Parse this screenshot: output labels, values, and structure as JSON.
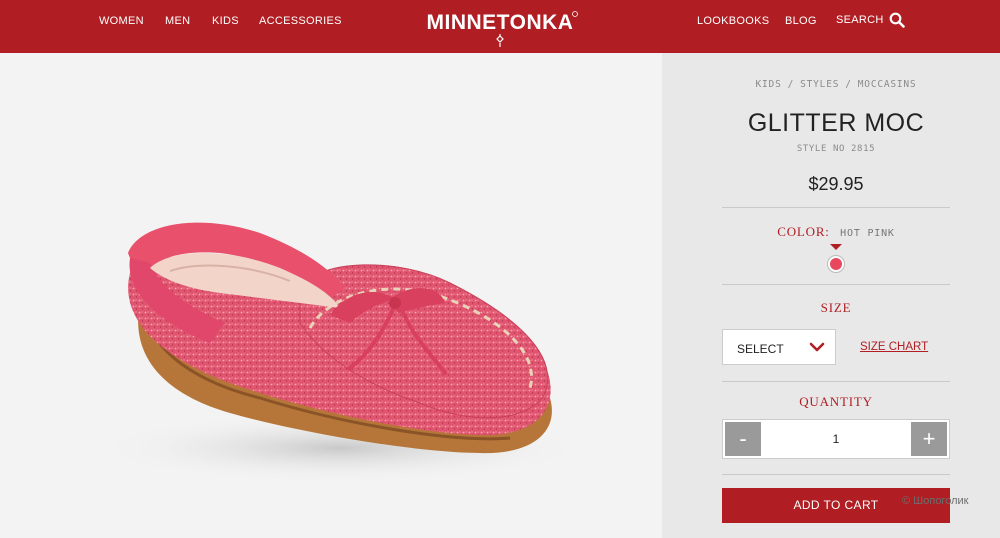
{
  "header": {
    "nav_left": [
      "WOMEN",
      "MEN",
      "KIDS",
      "ACCESSORIES"
    ],
    "logo": "MINNETONKA",
    "nav_right": [
      "LOOKBOOKS",
      "BLOG"
    ],
    "search_label": "SEARCH",
    "bg_color": "#b01e23"
  },
  "product": {
    "breadcrumb": [
      "KIDS",
      "STYLES",
      "MOCCASINS"
    ],
    "breadcrumb_separator": "/",
    "title": "GLITTER MOC",
    "style_no": "STYLE NO 2815",
    "price": "$29.95",
    "color_label": "COLOR:",
    "color_value": "HOT PINK",
    "swatch_color": "#e8475e",
    "size_label": "SIZE",
    "size_select": "SELECT",
    "size_chart_link": "SIZE CHART",
    "quantity_label": "QUANTITY",
    "quantity_minus": "-",
    "quantity_value": "1",
    "quantity_plus": "+",
    "add_to_cart": "ADD TO CART"
  },
  "watermark": "© Шопоголик",
  "icons": [
    "search-icon",
    "chevron-down-icon"
  ]
}
